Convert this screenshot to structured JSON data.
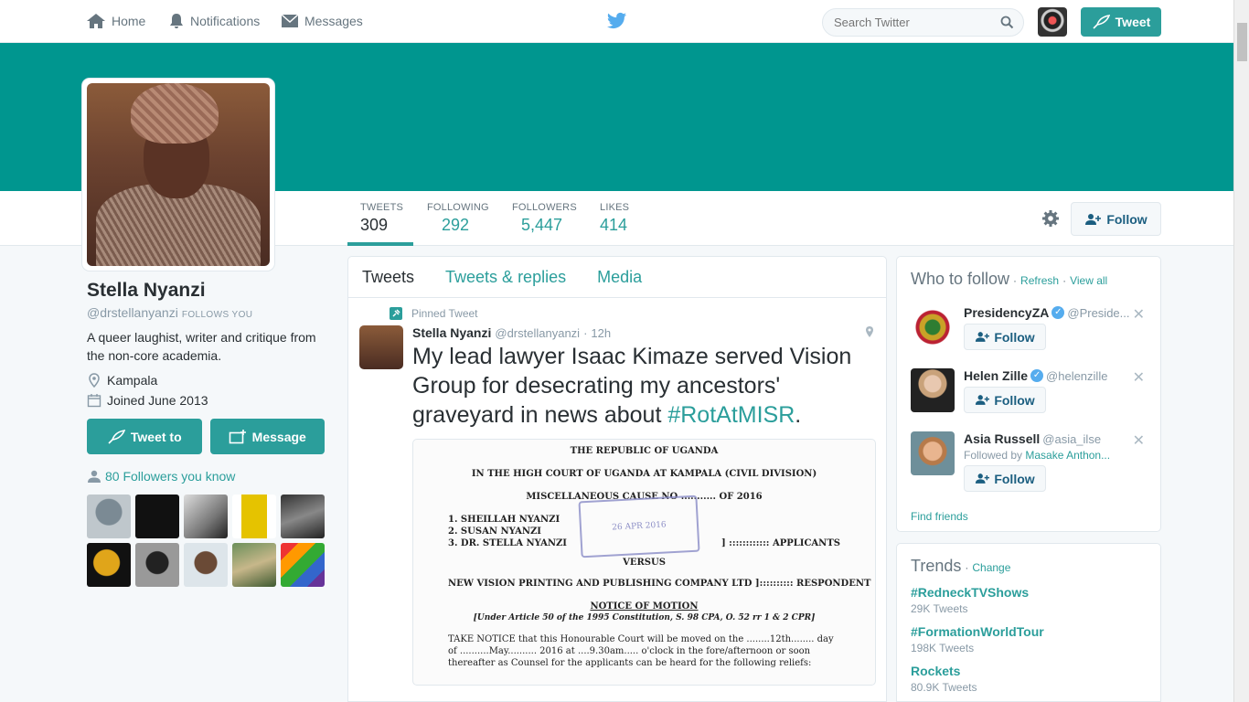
{
  "topnav": {
    "home": "Home",
    "notifications": "Notifications",
    "messages": "Messages",
    "search_placeholder": "Search Twitter",
    "tweet_button": "Tweet"
  },
  "profile": {
    "name": "Stella Nyanzi",
    "handle": "@drstellanyanzi",
    "follows_you": "FOLLOWS YOU",
    "bio": "A queer laughist, writer and critique from the non-core academia.",
    "location": "Kampala",
    "joined": "Joined June 2013",
    "tweet_to": "Tweet to",
    "message": "Message",
    "followers_you_know": "80 Followers you know"
  },
  "stats": [
    {
      "label": "TWEETS",
      "value": "309"
    },
    {
      "label": "FOLLOWING",
      "value": "292"
    },
    {
      "label": "FOLLOWERS",
      "value": "5,447"
    },
    {
      "label": "LIKES",
      "value": "414"
    }
  ],
  "follow_button": "Follow",
  "timeline": {
    "tabs": [
      "Tweets",
      "Tweets & replies",
      "Media"
    ],
    "pinned_label": "Pinned Tweet",
    "tweet": {
      "name": "Stella Nyanzi",
      "handle": "@drstellanyanzi",
      "sep": "·",
      "time": "12h",
      "text": "My lead lawyer Isaac Kimaze served Vision Group for desecrating my ancestors' graveyard in news about",
      "hashtag": "#RotAtMISR",
      "period": "."
    },
    "document": {
      "l1": "THE REPUBLIC OF UGANDA",
      "l2": "IN THE HIGH COURT OF UGANDA AT KAMPALA (CIVIL DIVISION)",
      "l3": "MISCELLANEOUS CAUSE NO ........... OF 2016",
      "l4": "1. SHEILLAH NYANZI",
      "l5": "2. SUSAN NYANZI",
      "l6": "3. DR. STELLA NYANZI",
      "l6b": "] :::::::::::: APPLICANTS",
      "l7": "VERSUS",
      "l8": "NEW VISION PRINTING AND PUBLISHING COMPANY LTD ]:::::::::: RESPONDENT",
      "l9": "NOTICE OF MOTION",
      "l10": "[Under Article 50 of the 1995 Constitution, S. 98 CPA, O. 52 rr 1 & 2 CPR]",
      "l11": "TAKE NOTICE that this Honourable Court will be moved on the ........12th........ day",
      "l12": "of ..........May.......... 2016 at ....9.30am..... o'clock in the fore/afternoon or soon",
      "l13": "thereafter as Counsel for the applicants can be heard for the following reliefs:",
      "stamp": "26 APR 2016"
    }
  },
  "who_to_follow": {
    "title": "Who to follow",
    "refresh": "Refresh",
    "view_all": "View all",
    "sep": "·",
    "suggestions": [
      {
        "name": "PresidencyZA",
        "handle": "@Preside...",
        "sub": "",
        "follow": "Follow"
      },
      {
        "name": "Helen Zille",
        "handle": "@helenzille",
        "sub": "",
        "follow": "Follow"
      },
      {
        "name": "Asia Russell",
        "handle": "@asia_ilse",
        "sub": "Followed by",
        "sub_link": "Masake Anthon...",
        "follow": "Follow"
      }
    ],
    "find_friends": "Find friends"
  },
  "trends": {
    "title": "Trends",
    "sep": "·",
    "change": "Change",
    "items": [
      {
        "name": "#RedneckTVShows",
        "count": "29K Tweets"
      },
      {
        "name": "#FormationWorldTour",
        "count": "198K Tweets"
      },
      {
        "name": "Rockets",
        "count": "80.9K Tweets"
      }
    ]
  },
  "colors": {
    "accent": "#2b9e9b",
    "banner": "#00968f"
  }
}
